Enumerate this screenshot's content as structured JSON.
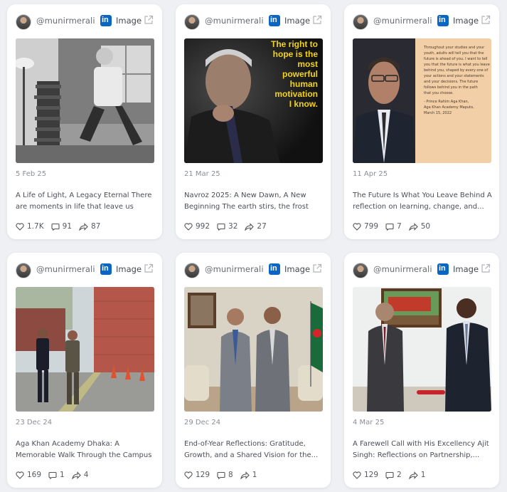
{
  "posts": [
    {
      "handle": "@munirmerali",
      "type": "Image",
      "date": "5 Feb 25",
      "title": "A Life of Light, A Legacy Eternal There are moments in life that leave us changed...",
      "likes": "1.7K",
      "comments": "91",
      "shares": "87"
    },
    {
      "handle": "@munirmerali",
      "type": "Image",
      "date": "21 Mar 25",
      "title": "Navroz 2025: A New Dawn, A New Beginning The earth stirs, the frost melts,...",
      "likes": "992",
      "comments": "32",
      "shares": "27",
      "image_text": [
        "The right to",
        "hope is the",
        "most",
        "powerful",
        "human",
        "motivation",
        "I know."
      ]
    },
    {
      "handle": "@munirmerali",
      "type": "Image",
      "date": "11 Apr 25",
      "title": "The Future Is What You Leave Behind A reflection on learning, change, and...",
      "likes": "799",
      "comments": "7",
      "shares": "50",
      "image_text": [
        "Throughout your studies and your",
        "youth, adults will tell you that the",
        "future is ahead of you. I want to tell",
        "you that the future is what you leave",
        "behind you, shaped by every one of",
        "your actions and your statements",
        "and your decisions. The future",
        "follows behind you in the path",
        "that you choose.",
        "",
        "- Prince Rahim Aga Khan,",
        "Aga Khan Academy Maputo,",
        "March 15, 2022"
      ]
    },
    {
      "handle": "@munirmerali",
      "type": "Image",
      "date": "23 Dec 24",
      "title": "Aga Khan Academy Dhaka: A Memorable Walk Through the Campus with HE Riaz...",
      "likes": "169",
      "comments": "1",
      "shares": "4"
    },
    {
      "handle": "@munirmerali",
      "type": "Image",
      "date": "29 Dec 24",
      "title": "End-of-Year Reflections: Gratitude, Growth, and a Shared Vision for the...",
      "likes": "129",
      "comments": "8",
      "shares": "1"
    },
    {
      "handle": "@munirmerali",
      "type": "Image",
      "date": "4 Mar 25",
      "title": "A Farewell Call with His Excellency Ajit Singh: Reflections on Partnership,...",
      "likes": "129",
      "comments": "2",
      "shares": "1"
    }
  ],
  "colors": {
    "linkedin": "#0a66c2",
    "background": "#eef0f3",
    "quote_yellow": "#f2d21c"
  },
  "icons": {
    "network": "linkedin-icon",
    "open": "external-link-icon",
    "likes": "heart-icon",
    "comments": "comment-icon",
    "shares": "share-icon"
  }
}
